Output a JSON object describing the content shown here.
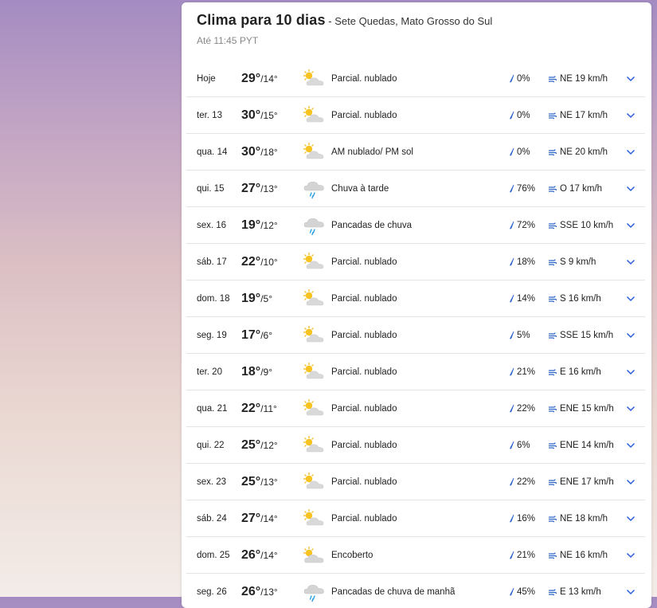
{
  "header": {
    "title": "Clima para 10 dias",
    "separator": " - ",
    "location": "Sete Quedas, Mato Grosso do Sul",
    "updated": "Até 11:45 PYT"
  },
  "colors": {
    "accent": "#2a5fd6",
    "rain_icon": "#2c63c9"
  },
  "rows": [
    {
      "day": "Hoje",
      "high": "29°",
      "low": "/14°",
      "icon": "partly-cloudy-icon",
      "condition": "Parcial. nublado",
      "rain": "0%",
      "wind": "NE 19 km/h"
    },
    {
      "day": "ter. 13",
      "high": "30°",
      "low": "/15°",
      "icon": "partly-cloudy-icon",
      "condition": "Parcial. nublado",
      "rain": "0%",
      "wind": "NE 17 km/h"
    },
    {
      "day": "qua. 14",
      "high": "30°",
      "low": "/18°",
      "icon": "partly-cloudy-icon",
      "condition": "AM nublado/ PM sol",
      "rain": "0%",
      "wind": "NE 20 km/h"
    },
    {
      "day": "qui. 15",
      "high": "27°",
      "low": "/13°",
      "icon": "rain-cloud-icon",
      "condition": "Chuva à tarde",
      "rain": "76%",
      "wind": "O 17 km/h"
    },
    {
      "day": "sex. 16",
      "high": "19°",
      "low": "/12°",
      "icon": "rain-cloud-icon",
      "condition": "Pancadas de chuva",
      "rain": "72%",
      "wind": "SSE 10 km/h"
    },
    {
      "day": "sáb. 17",
      "high": "22°",
      "low": "/10°",
      "icon": "partly-cloudy-icon",
      "condition": "Parcial. nublado",
      "rain": "18%",
      "wind": "S 9 km/h"
    },
    {
      "day": "dom. 18",
      "high": "19°",
      "low": "/5°",
      "icon": "partly-cloudy-icon",
      "condition": "Parcial. nublado",
      "rain": "14%",
      "wind": "S 16 km/h"
    },
    {
      "day": "seg. 19",
      "high": "17°",
      "low": "/6°",
      "icon": "partly-cloudy-icon",
      "condition": "Parcial. nublado",
      "rain": "5%",
      "wind": "SSE 15 km/h"
    },
    {
      "day": "ter. 20",
      "high": "18°",
      "low": "/9°",
      "icon": "partly-cloudy-icon",
      "condition": "Parcial. nublado",
      "rain": "21%",
      "wind": "E 16 km/h"
    },
    {
      "day": "qua. 21",
      "high": "22°",
      "low": "/11°",
      "icon": "partly-cloudy-icon",
      "condition": "Parcial. nublado",
      "rain": "22%",
      "wind": "ENE 15 km/h"
    },
    {
      "day": "qui. 22",
      "high": "25°",
      "low": "/12°",
      "icon": "partly-cloudy-icon",
      "condition": "Parcial. nublado",
      "rain": "6%",
      "wind": "ENE 14 km/h"
    },
    {
      "day": "sex. 23",
      "high": "25°",
      "low": "/13°",
      "icon": "partly-cloudy-icon",
      "condition": "Parcial. nublado",
      "rain": "22%",
      "wind": "ENE 17 km/h"
    },
    {
      "day": "sáb. 24",
      "high": "27°",
      "low": "/14°",
      "icon": "partly-cloudy-icon",
      "condition": "Parcial. nublado",
      "rain": "16%",
      "wind": "NE 18 km/h"
    },
    {
      "day": "dom. 25",
      "high": "26°",
      "low": "/14°",
      "icon": "overcast-icon",
      "condition": "Encoberto",
      "rain": "21%",
      "wind": "NE 16 km/h"
    },
    {
      "day": "seg. 26",
      "high": "26°",
      "low": "/13°",
      "icon": "rain-cloud-icon",
      "condition": "Pancadas de chuva de manhã",
      "rain": "45%",
      "wind": "E 13 km/h"
    }
  ]
}
